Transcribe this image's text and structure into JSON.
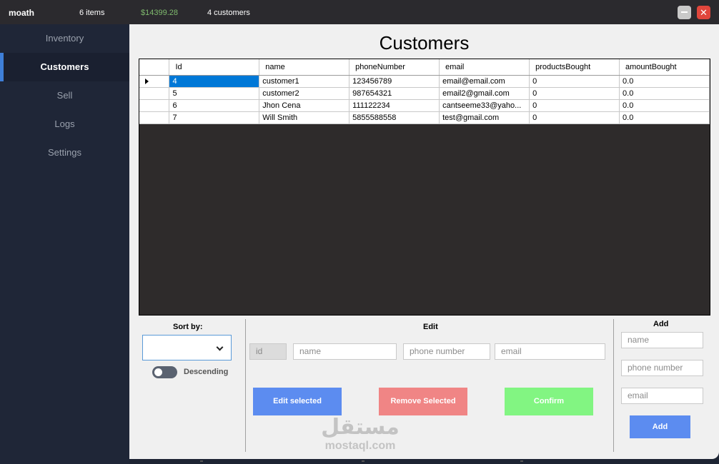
{
  "titlebar": {
    "user": "moath",
    "items_count": "6 items",
    "balance": "$14399.28",
    "customers_count": "4 customers",
    "close_glyph": "✕"
  },
  "sidebar": {
    "items": [
      {
        "label": "Inventory"
      },
      {
        "label": "Customers",
        "active": true
      },
      {
        "label": "Sell"
      },
      {
        "label": "Logs"
      },
      {
        "label": "Settings"
      }
    ]
  },
  "main": {
    "title": "Customers",
    "table": {
      "columns": [
        "Id",
        "name",
        "phoneNumber",
        "email",
        "productsBought",
        "amountBought"
      ],
      "rows": [
        [
          "4",
          "customer1",
          "123456789",
          "email@email.com",
          "0",
          "0.0"
        ],
        [
          "5",
          "customer2",
          "987654321",
          "email2@gmail.com",
          "0",
          "0.0"
        ],
        [
          "6",
          "Jhon Cena",
          "111122234",
          "cantseeme33@yaho...",
          "0",
          "0.0"
        ],
        [
          "7",
          "Will Smith",
          "5855588558",
          "test@gmail.com",
          "0",
          "0.0"
        ]
      ]
    }
  },
  "sort": {
    "label": "Sort by:",
    "selected": "",
    "descending_label": "Descending"
  },
  "edit": {
    "label": "Edit",
    "id_placeholder": "id",
    "name_placeholder": "name",
    "phone_placeholder": "phone number",
    "email_placeholder": "email",
    "edit_selected": "Edit selected",
    "remove_selected": "Remove Selected",
    "confirm": "Confirm"
  },
  "add": {
    "label": "Add",
    "name_placeholder": "name",
    "phone_placeholder": "phone number",
    "email_placeholder": "email",
    "button": "Add"
  },
  "watermark": {
    "arabic": "مستقل",
    "latin": "mostaql.com"
  },
  "colors": {
    "accent": "#3e7fd8",
    "balance": "#7fba6e",
    "edit_button": "#5c8cf0",
    "remove_button": "#f08585",
    "confirm_button": "#82f582",
    "close_button": "#e0463c"
  }
}
